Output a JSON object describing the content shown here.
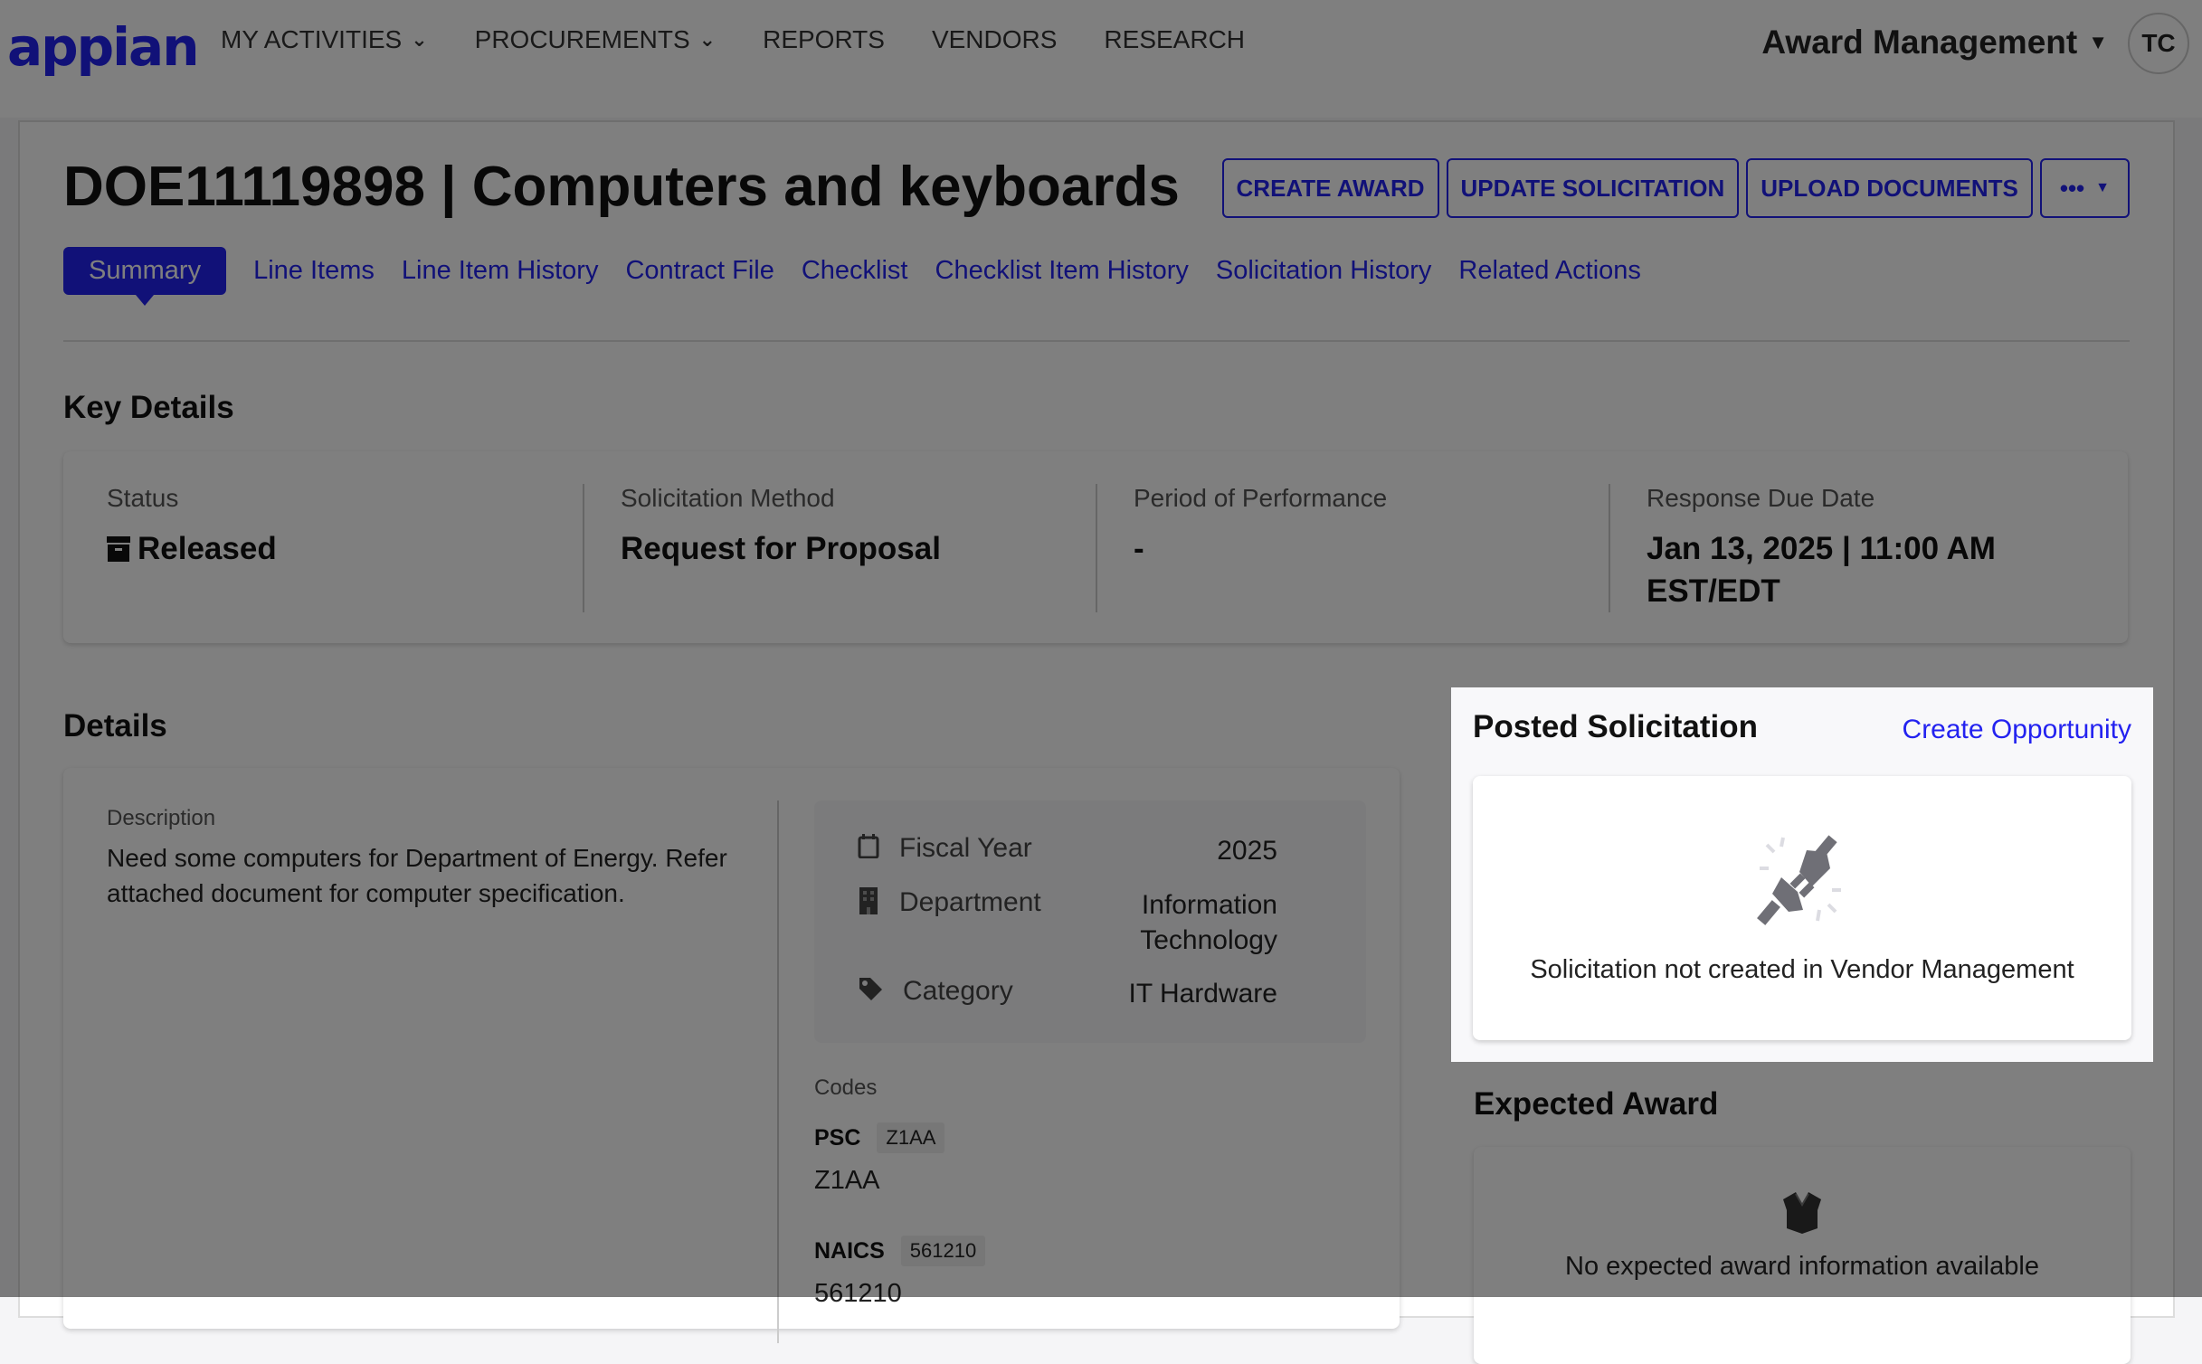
{
  "header": {
    "logo": "appian",
    "nav": [
      {
        "label": "MY ACTIVITIES",
        "has_dropdown": true
      },
      {
        "label": "PROCUREMENTS",
        "has_dropdown": true
      },
      {
        "label": "REPORTS",
        "has_dropdown": false
      },
      {
        "label": "VENDORS",
        "has_dropdown": false
      },
      {
        "label": "RESEARCH",
        "has_dropdown": false
      }
    ],
    "app_switcher": "Award Management",
    "user_initials": "TC"
  },
  "record": {
    "title": "DOE11119898 | Computers and keyboards",
    "actions": [
      "CREATE AWARD",
      "UPDATE SOLICITATION",
      "UPLOAD DOCUMENTS",
      "•••"
    ],
    "tabs": [
      {
        "label": "Summary",
        "active": true
      },
      {
        "label": "Line Items"
      },
      {
        "label": "Line Item History"
      },
      {
        "label": "Contract File"
      },
      {
        "label": "Checklist"
      },
      {
        "label": "Checklist Item History"
      },
      {
        "label": "Solicitation History"
      },
      {
        "label": "Related Actions"
      }
    ]
  },
  "key_details": {
    "heading": "Key Details",
    "fields": [
      {
        "label": "Status",
        "value": "Released",
        "icon": "archive-icon"
      },
      {
        "label": "Solicitation Method",
        "value": "Request for Proposal"
      },
      {
        "label": "Period of Performance",
        "value": "-"
      },
      {
        "label": "Response Due Date",
        "value": "Jan 13, 2025 | 11:00 AM EST/EDT"
      }
    ]
  },
  "details": {
    "heading": "Details",
    "description_label": "Description",
    "description": "Need some computers for Department of Energy. Refer attached document for computer specification.",
    "meta": [
      {
        "icon": "calendar-icon",
        "label": "Fiscal Year",
        "value": "2025"
      },
      {
        "icon": "building-icon",
        "label": "Department",
        "value": "Information Technology"
      },
      {
        "icon": "tag-icon",
        "label": "Category",
        "value": "IT Hardware"
      }
    ],
    "codes_label": "Codes",
    "codes": [
      {
        "key": "PSC",
        "chip": "Z1AA",
        "value": "Z1AA"
      },
      {
        "key": "NAICS",
        "chip": "561210",
        "value": "561210"
      }
    ]
  },
  "posted_solicitation": {
    "heading": "Posted Solicitation",
    "link": "Create Opportunity",
    "empty_message": "Solicitation not created in Vendor Management"
  },
  "expected_award": {
    "heading": "Expected Award",
    "empty_message": "No expected award information available"
  },
  "colors": {
    "accent": "#2322f0",
    "overlay": "rgba(0,0,0,0.5)"
  }
}
